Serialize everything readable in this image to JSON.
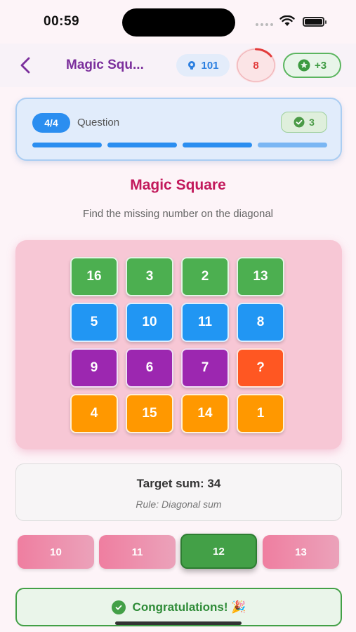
{
  "status": {
    "time": "00:59"
  },
  "appbar": {
    "title": "Magic Squ...",
    "hints": "101",
    "timer": "8",
    "timer_remaining_fraction": 0.15,
    "score": "+3"
  },
  "question_card": {
    "badge": "4/4",
    "label": "Question",
    "correct_count": "3",
    "progress_segments_completed": 3,
    "progress_segments_total": 4
  },
  "puzzle": {
    "title": "Magic Square",
    "subtitle": "Find the missing number on the diagonal",
    "rows": [
      [
        "16",
        "3",
        "2",
        "13"
      ],
      [
        "5",
        "10",
        "11",
        "8"
      ],
      [
        "9",
        "6",
        "7",
        "?"
      ],
      [
        "4",
        "15",
        "14",
        "1"
      ]
    ]
  },
  "info": {
    "target": "Target sum: 34",
    "rule": "Rule: Diagonal sum"
  },
  "options": [
    {
      "label": "10"
    },
    {
      "label": "11"
    },
    {
      "label": "12"
    },
    {
      "label": "13"
    }
  ],
  "selected_option": "12",
  "banner": {
    "text": "Congratulations! 🎉"
  },
  "colors": {
    "accent_purple": "#7b2f9c",
    "title_pink": "#c2185b",
    "row_green": "#4caf50",
    "row_blue": "#2196f3",
    "row_purple": "#9c27b0",
    "row_orange": "#ff9800",
    "missing_cell": "#ff5722",
    "success": "#43a047"
  },
  "icons": {
    "back": "chevron-left-icon",
    "hint": "lightbulb-icon",
    "score": "star-icon",
    "check": "check-circle-icon"
  }
}
